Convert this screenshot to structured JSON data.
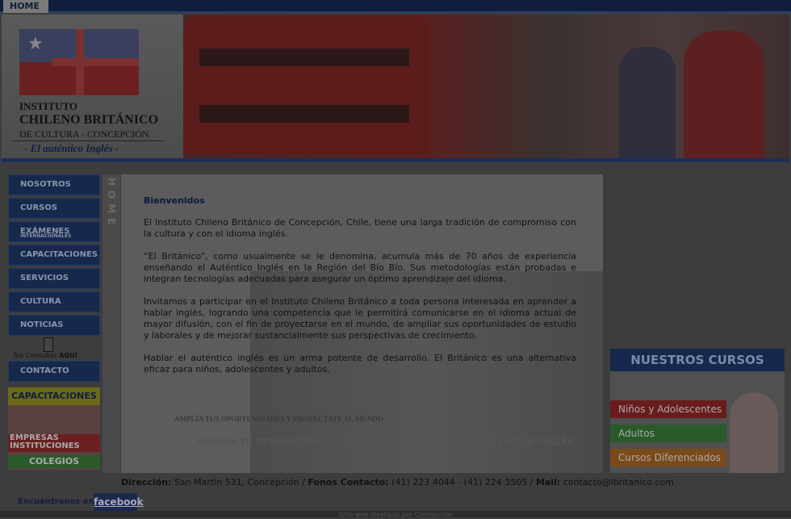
{
  "topbar": {
    "home_label": "HOME"
  },
  "header": {
    "institute_line1": "INSTITUTO",
    "institute_line2": "CHILENO BRITÁNICO",
    "institute_line3": "DE CULTURA - CONCEPCIÓN",
    "tagline": "- El auténtico Inglés -"
  },
  "nav": {
    "items": [
      {
        "label": "NOSOTROS"
      },
      {
        "label": "CURSOS"
      },
      {
        "label": "EXÁMENES",
        "sub": "INTERNACIONALES"
      },
      {
        "label": "CAPACITACIONES"
      },
      {
        "label": "SERVICIOS"
      },
      {
        "label": "CULTURA"
      },
      {
        "label": "NOTICIAS"
      }
    ],
    "consultas_prefix": "Tus Consultas",
    "consultas_bold": "AQUÍ",
    "contacto": "CONTACTO"
  },
  "promo": {
    "capacitaciones": "CAPACITACIONES",
    "empresas": "EMPRESAS",
    "instituciones": "INSTITUCIONES",
    "colegios": "COLEGIOS"
  },
  "sidebar_vertical": "HOME",
  "content": {
    "title": "Bienvenidos",
    "p1": "El Instituto Chileno Británico de Concepción, Chile, tiene una larga tradición de compromiso con la cultura y con el idioma inglés.",
    "p2": "“El Británico”, como usualmente se le denomina, acumula más de 70 años de experiencia enseñando el Auténtico Inglés en la Región del Bío Bío. Sus metodologías están probadas e integran tecnologías adecuadas para asegurar un óptimo aprendizaje del idioma.",
    "p3": "Invitamos a participar en el Instituto Chileno Británico a toda persona interesada en aprender a hablar inglés, logrando una competencia que le permitirá comunicarse en el idioma actual de mayor difusión, con el fin de proyectarse en el mundo, de ampliar sus oportunidades de estudio y laborales y de mejorar sustancialmente sus perspectivas de crecimiento.",
    "p4": "Hablar el auténtico inglés es un arma potente de desarrollo. El Británico es una alternativa eficaz para niños, adolescentes y adultos.",
    "slogan1": "AMPLÍA TUS OPORTUNIDADES Y PROYÉCTATE AL MUNDO",
    "slogan2": "MEJORA TU PERSPECTIVA Y CAMBIA TU FUTURO CON EL AUTÉNTICO INGLÉS"
  },
  "courses": {
    "header": "NUESTROS CURSOS",
    "items": [
      {
        "label": "Niños y Adolescentes",
        "color": "#6a1c1c"
      },
      {
        "label": "Adultos",
        "color": "#2a5a2a"
      },
      {
        "label": "Cursos Diferenciados",
        "color": "#7a4a1a"
      }
    ]
  },
  "footer": {
    "dir_label": "Dirección:",
    "dir_value": "San Martín 531, Concepción /",
    "fonos_label": "Fonos Contacto:",
    "fonos_value": "(41) 223 4044 - (41) 224 3505 /",
    "mail_label": "Mail:",
    "mail_value": "contacto@ibritanico.com",
    "find_us": "Encuéntranos en",
    "facebook": "facebook",
    "bottom_text": "Sitio web diseñado por Concepción"
  },
  "colors": {
    "nav_bg": "#16284c",
    "topbar": "#0e1e3c",
    "overlay": "dimmed"
  }
}
